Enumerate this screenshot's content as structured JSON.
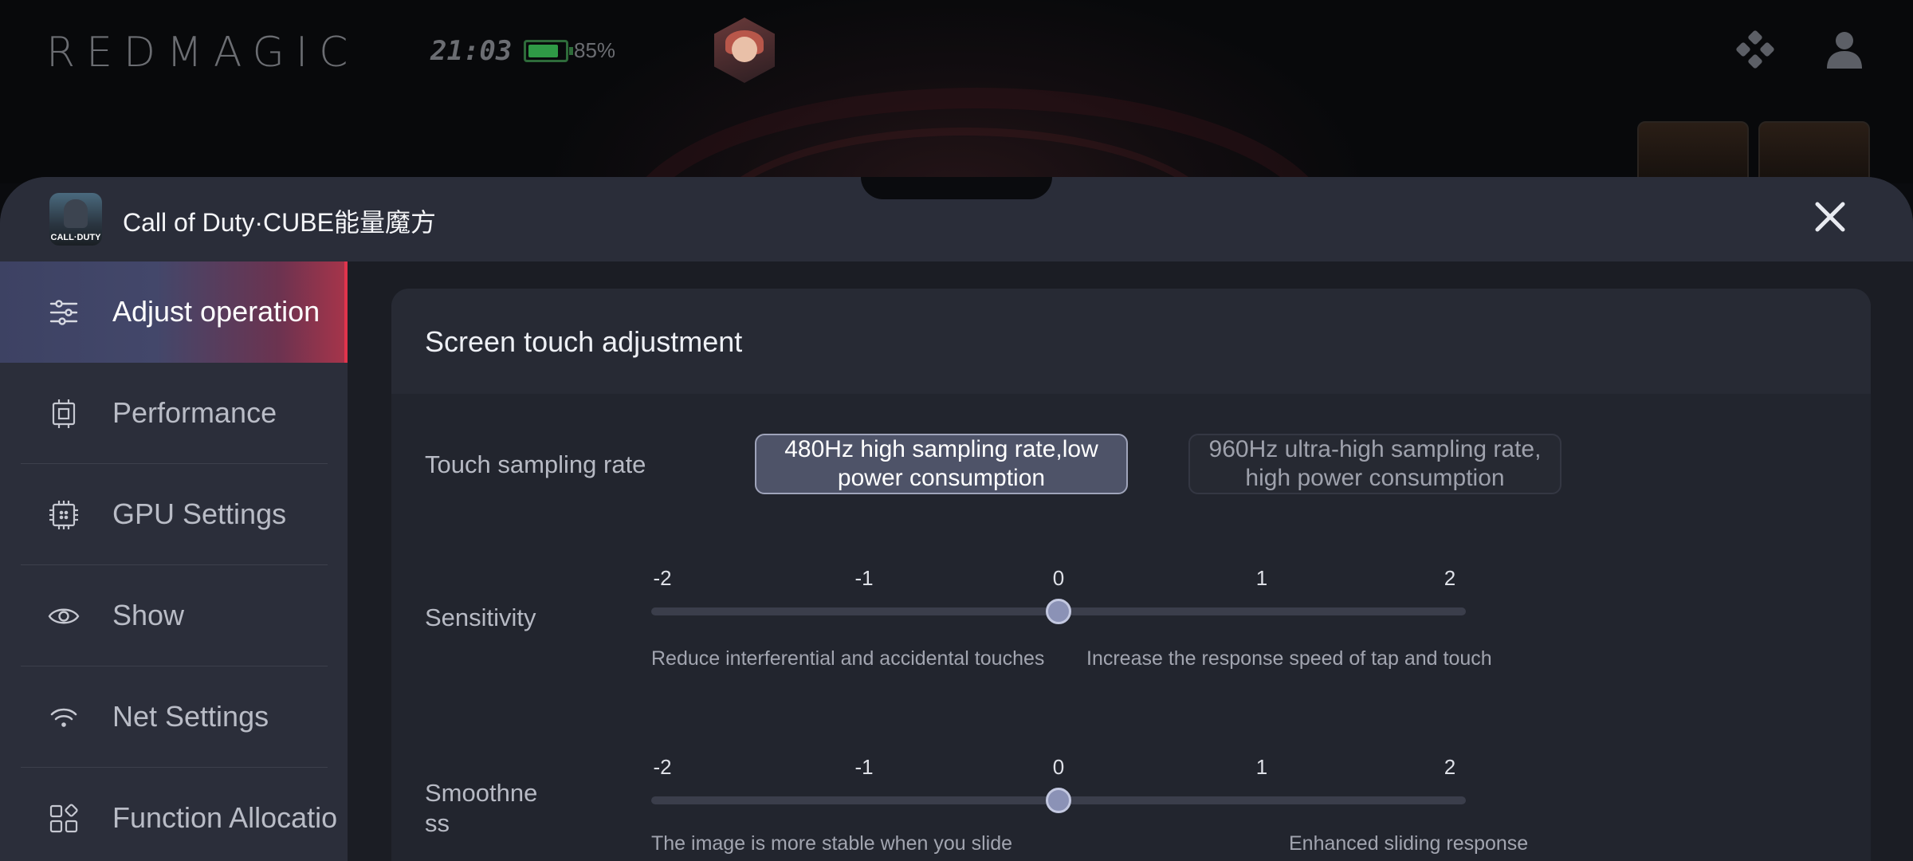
{
  "statusbar": {
    "brand": "REDMAGIC",
    "time": "21:03",
    "battery": "85%",
    "battery_level": 0.85
  },
  "panel": {
    "app_title": "Call of Duty·CUBE能量魔方",
    "app_icon_text": "CALL·DUTY"
  },
  "sidebar": {
    "items": [
      {
        "label": "Adjust operation",
        "icon": "sliders-icon",
        "active": true
      },
      {
        "label": "Performance",
        "icon": "chip-icon"
      },
      {
        "label": "GPU Settings",
        "icon": "gpu-icon"
      },
      {
        "label": "Show",
        "icon": "eye-icon"
      },
      {
        "label": "Net Settings",
        "icon": "wifi-icon"
      },
      {
        "label": "Function Allocatio",
        "icon": "apps-icon"
      }
    ]
  },
  "main": {
    "section_title": "Screen touch adjustment",
    "touch_sampling": {
      "label": "Touch sampling rate",
      "options": [
        {
          "text": "480Hz high sampling rate,low power consumption",
          "selected": true
        },
        {
          "text": "960Hz ultra-high sampling rate, high power consumption",
          "selected": false
        }
      ]
    },
    "sensitivity": {
      "label": "Sensitivity",
      "ticks": [
        "-2",
        "-1",
        "0",
        "1",
        "2"
      ],
      "value": 0,
      "hint_left": "Reduce interferential and accidental touches",
      "hint_right": "Increase the response speed of tap and touch"
    },
    "smoothness": {
      "label": "Smoothne ss",
      "ticks": [
        "-2",
        "-1",
        "0",
        "1",
        "2"
      ],
      "value": 0,
      "hint_left": "The image is more stable when you slide",
      "hint_right": "Enhanced sliding response"
    }
  },
  "colors": {
    "accent": "#e0344c",
    "panel_bg": "#1b1d24",
    "sidebar_bg": "#2b2e3a",
    "battery_green": "#2f9a46",
    "thumb": "#8b92b6"
  }
}
